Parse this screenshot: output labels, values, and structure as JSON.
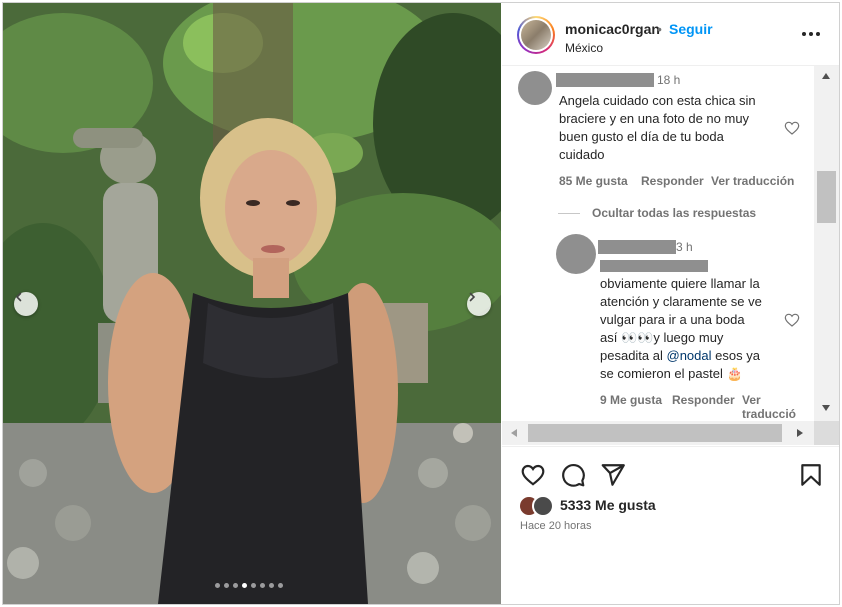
{
  "post": {
    "username": "monicac0rgan",
    "separator": "•",
    "follow_label": "Seguir",
    "location": "México",
    "likes_label": "5333 Me gusta",
    "posted_time": "Hace 20 horas",
    "carousel": {
      "dot_count": 8,
      "active_index": 3
    }
  },
  "comments": [
    {
      "time": "18 h",
      "lines": [
        "Angela cuidado con esta chica sin",
        "braciere y en una foto de no muy",
        "buen gusto el día de tu boda",
        "cuidado"
      ],
      "likes": "85 Me gusta",
      "reply_label": "Responder",
      "translate_label": "Ver traducción"
    }
  ],
  "hide_replies_label": "Ocultar todas las respuestas",
  "reply": {
    "time": "3 h",
    "lines": [
      "obviamente quiere llamar la",
      "atención y claramente se ve",
      "vulgar para ir a una boda",
      "así 👀👀y luego muy",
      "pesadita al ",
      "se comieron el pastel 🎂"
    ],
    "mention": "@nodal",
    "mention_after": " esos ya",
    "likes": "9 Me gusta",
    "reply_label": "Responder",
    "translate_label": "Ver traducció"
  },
  "icons": {
    "more": "more-horizontal-icon",
    "like": "heart-icon",
    "comment": "comment-icon",
    "share": "send-icon",
    "save": "bookmark-icon"
  }
}
